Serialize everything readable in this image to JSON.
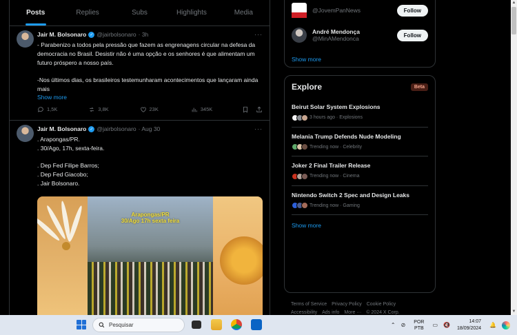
{
  "tabs": [
    {
      "label": "Posts"
    },
    {
      "label": "Replies"
    },
    {
      "label": "Subs"
    },
    {
      "label": "Highlights"
    },
    {
      "label": "Media"
    }
  ],
  "tweets": [
    {
      "name": "Jair M. Bolsonaro",
      "handle": "@jairbolsonaro",
      "time": "· 3h",
      "body": "- Parabenizo a todos pela pressão que fazem as engrenagens circular na defesa da democracia no Brasil. Desistir não é uma opção e os senhores é que alimentam um futuro próspero a nosso país.\n\n-Nos últimos dias, os brasileiros testemunharam acontecimentos que lançaram ainda mais",
      "show_more": "Show more",
      "stats": {
        "replies": "1,5K",
        "reposts": "3,8K",
        "likes": "23K",
        "views": "345K"
      }
    },
    {
      "name": "Jair M. Bolsonaro",
      "handle": "@jairbolsonaro",
      "time": "· Aug 30",
      "body": ". Arapongas/PR.\n. 30/Ago, 17h, sexta-feira.\n\n. Dep Fed Filipe Barros;\n. Dep Fed Giacobo;\n. Jair Bolsonaro.",
      "media_caption_1": "Arapongas/PR",
      "media_caption_2": "30/Ago 17h sexta feira"
    }
  ],
  "who_to_follow": [
    {
      "name": "",
      "handle": "@JovemPanNews",
      "button": "Follow"
    },
    {
      "name": "André Mendonça",
      "handle": "@MinAMendonca",
      "button": "Follow"
    }
  ],
  "who_show_more": "Show more",
  "explore": {
    "title": "Explore",
    "badge": "Beta",
    "items": [
      {
        "headline": "Beirut Solar System Explosions",
        "meta": "3 hours ago · Explosions"
      },
      {
        "headline": "Melania Trump Defends Nude Modeling",
        "meta": "Trending now · Celebrity"
      },
      {
        "headline": "Joker 2 Final Trailer Release",
        "meta": "Trending now · Cinema"
      },
      {
        "headline": "Nintendo Switch 2 Spec and Design Leaks",
        "meta": "Trending now · Gaming"
      }
    ],
    "show_more": "Show more"
  },
  "footer": {
    "line1": [
      "Terms of Service",
      "Privacy Policy",
      "Cookie Policy"
    ],
    "line2": [
      "Accessibility",
      "Ads info",
      "More ···",
      "© 2024 X Corp."
    ]
  },
  "taskbar": {
    "search_placeholder": "Pesquisar",
    "lang_top": "POR",
    "lang_bottom": "PTB",
    "time": "14:07",
    "date": "18/09/2024"
  },
  "colors": {
    "accent": "#1d9bf0",
    "background": "#000000",
    "text": "#e7e9ea",
    "muted": "#71767b",
    "beta_badge": "#4a1f16"
  }
}
